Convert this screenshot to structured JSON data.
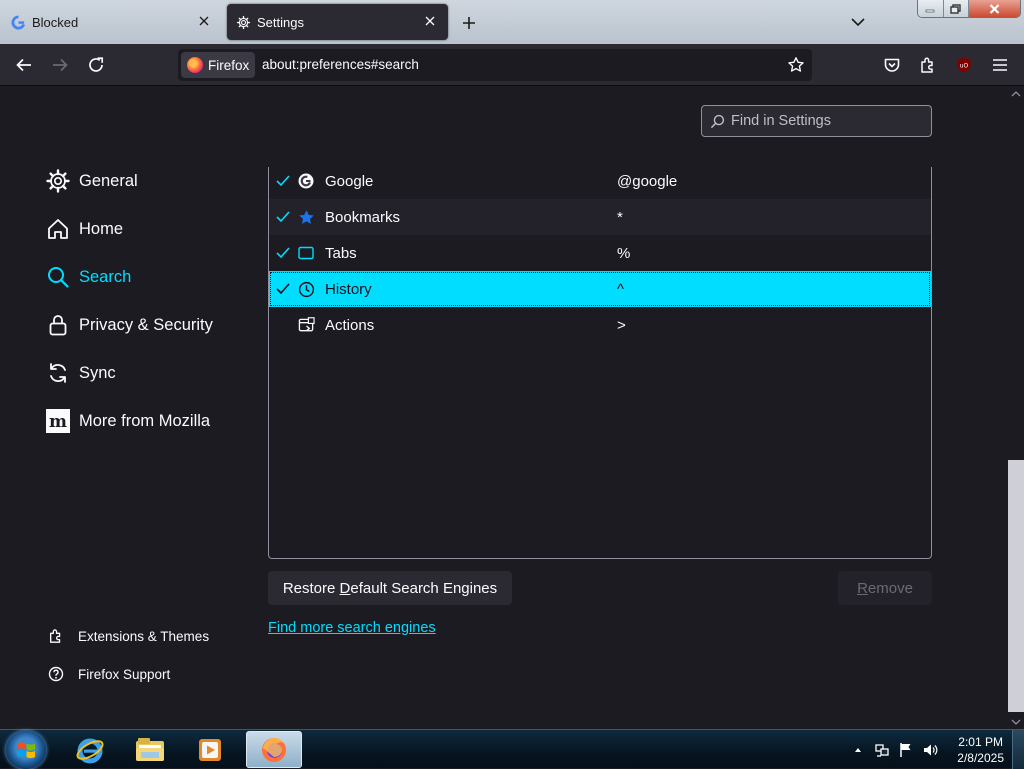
{
  "tabs": [
    {
      "title": "Blocked",
      "icon": "google-icon",
      "active": false
    },
    {
      "title": "Settings",
      "icon": "gear-icon",
      "active": true
    }
  ],
  "nav": {
    "identity_label": "Firefox",
    "url": "about:preferences#search"
  },
  "find": {
    "placeholder": "Find in Settings"
  },
  "categories": [
    {
      "label": "General",
      "icon": "gear-icon"
    },
    {
      "label": "Home",
      "icon": "home-icon"
    },
    {
      "label": "Search",
      "icon": "search-icon",
      "selected": true
    },
    {
      "label": "Privacy & Security",
      "icon": "lock-icon"
    },
    {
      "label": "Sync",
      "icon": "sync-icon"
    },
    {
      "label": "More from Mozilla",
      "icon": "mozilla-icon"
    }
  ],
  "footer": [
    {
      "label": "Extensions & Themes",
      "icon": "puzzle-icon"
    },
    {
      "label": "Firefox Support",
      "icon": "help-icon"
    }
  ],
  "shortcuts": [
    {
      "name": "Google",
      "keyword": "@google",
      "checked": true,
      "icon": "google-icon"
    },
    {
      "name": "Bookmarks",
      "keyword": "*",
      "checked": true,
      "icon": "star-icon"
    },
    {
      "name": "Tabs",
      "keyword": "%",
      "checked": true,
      "icon": "tab-icon"
    },
    {
      "name": "History",
      "keyword": "^",
      "checked": true,
      "icon": "clock-icon",
      "selected": true
    },
    {
      "name": "Actions",
      "keyword": ">",
      "checked": false,
      "icon": "actions-icon"
    }
  ],
  "buttons": {
    "restore_pre": "Restore ",
    "restore_key": "D",
    "restore_post": "efault Search Engines",
    "remove_key": "R",
    "remove_post": "emove"
  },
  "find_more": "Find more search engines",
  "clock": {
    "time": "2:01 PM",
    "date": "2/8/2025"
  },
  "colors": {
    "accent": "#00ddff",
    "page_bg": "#1c1b22",
    "toolbar_bg": "#2b2a33",
    "google_blue": "#1a73e8"
  }
}
